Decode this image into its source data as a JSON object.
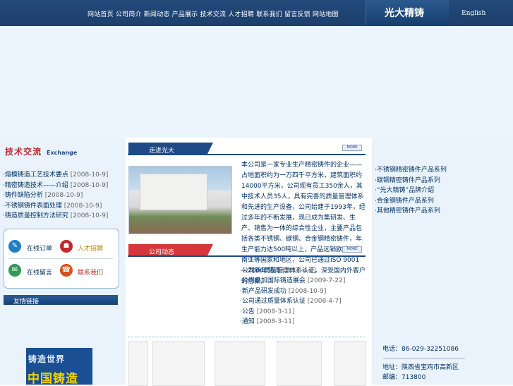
{
  "header": {
    "nav_text": "网站首页  公司简介  新闻动态  产品展示  技术交流  人才招聘  联系我们  留言反馈  网站地图",
    "logo_text": "光大精铸",
    "lang_label": "English"
  },
  "tech": {
    "title": "技术交流",
    "subtitle": "Exchange",
    "items": [
      {
        "label": "·熔模铸造工艺技术要点",
        "date": "[2008-10-9]"
      },
      {
        "label": "·精密铸造技术——介绍",
        "date": "[2008-10-9]"
      },
      {
        "label": "·铸件缺陷分析",
        "date": "[2008-10-9]"
      },
      {
        "label": "·不锈钢铸件表面处理",
        "date": "[2008-10-9]"
      },
      {
        "label": "·铸造质量控制方法研究",
        "date": "[2008-10-9]"
      }
    ]
  },
  "services": {
    "item1": "在线订单",
    "item2": "人才招聘",
    "item3": "在线留言",
    "item4": "联系我们"
  },
  "links": {
    "title": "友情链接",
    "logo_top": "铸造世界",
    "logo_bottom": "中国铸造"
  },
  "about": {
    "title": "走进光大",
    "more": "MORE",
    "text": "本公司是一家专业生产精密铸件的企业——占地面积约为一万四千平方米，建筑面积约14000平方米，公司现有员工350余人，其中技术人员35人，具有完善的质量管理体系和先进的生产设备，公司始建于1993年，经过多年的不断发展，现已成为集研发、生产、销售为一体的综合性企业，主要产品包括各类不锈钢、碳钢、合金钢精密铸件，年生产能力达500吨以上，产品远销欧美及东南亚等国家和地区，公司已通过ISO 9001—2000质量管理体系认证，深受国内外客户的信赖。"
  },
  "news": {
    "title": "公司动态",
    "more": "MORE",
    "items": [
      {
        "label": "·公司新年贺词",
        "date": "[2011-4-6]"
      },
      {
        "label": "·公司参加国际铸造展会",
        "date": "[2009-7-22]"
      },
      {
        "label": "·新产品研发成功",
        "date": "[2008-10-9]"
      },
      {
        "label": "·公司通过质量体系认证",
        "date": "[2008-4-7]"
      },
      {
        "label": "·公告",
        "date": "[2008-3-11]"
      },
      {
        "label": "·通知",
        "date": "[2008-3-11]"
      }
    ]
  },
  "right": {
    "links": [
      "·不锈钢精密铸件产品系列",
      "·碳钢精密铸件产品系列",
      "·“光大精铸”品牌介绍",
      "·合金钢铸件产品系列",
      "·其他精密铸件产品系列"
    ],
    "phone": "电话：86-029-32251086",
    "address": "地址：陕西省宝鸡市高新区",
    "postcode": "邮编：713800"
  },
  "colors": {
    "header_bg": "#1d3f6c",
    "accent_red": "#c0282d",
    "link_blue": "#003366"
  }
}
